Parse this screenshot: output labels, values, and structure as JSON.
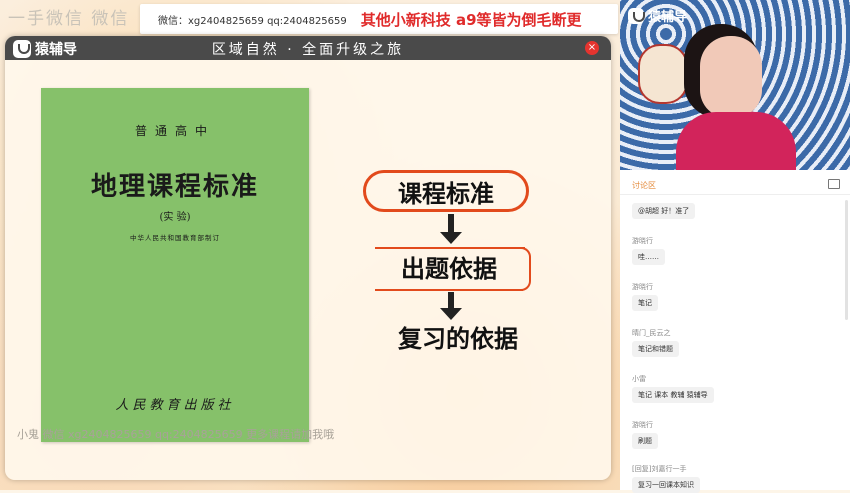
{
  "top_watermark": "一手微信 微信",
  "banner": {
    "contact": "微信：xg2404825659  qq:2404825659",
    "promo": "其他小新科技 a9等皆为倒毛断更"
  },
  "lesson": {
    "logo_text": "猿辅导",
    "title": "区域自然 · 全面升级之旅",
    "close": "×",
    "book": {
      "series": "普通高中",
      "title": "地理课程标准",
      "subtitle": "(实 验)",
      "issuer": "中华人民共和国教育部制订",
      "press": "人民教育出版社"
    },
    "flow": {
      "step1": "课程标准",
      "step2": "出题依据",
      "step3": "复习的依据"
    },
    "bottom_watermark": "小鬼 微信 xg2404825659  qq:2404825659  更多课程请加我哦"
  },
  "video": {
    "logo_text": "猿辅导"
  },
  "chat": {
    "tab": "讨论区",
    "messages": [
      {
        "user": "",
        "text": "@胡超 好！准了"
      },
      {
        "user": "游晓行",
        "text": "哇……"
      },
      {
        "user": "游晓行",
        "text": "笔记"
      },
      {
        "user": "晴门_民云之",
        "text": "笔记和错题"
      },
      {
        "user": "小雷",
        "text": "笔记 课本 教辅 猿辅导"
      },
      {
        "user": "游晓行",
        "text": "刷题"
      },
      {
        "user": "[回复]刘嘉行一手",
        "text": "复习一回课本知识"
      }
    ]
  }
}
